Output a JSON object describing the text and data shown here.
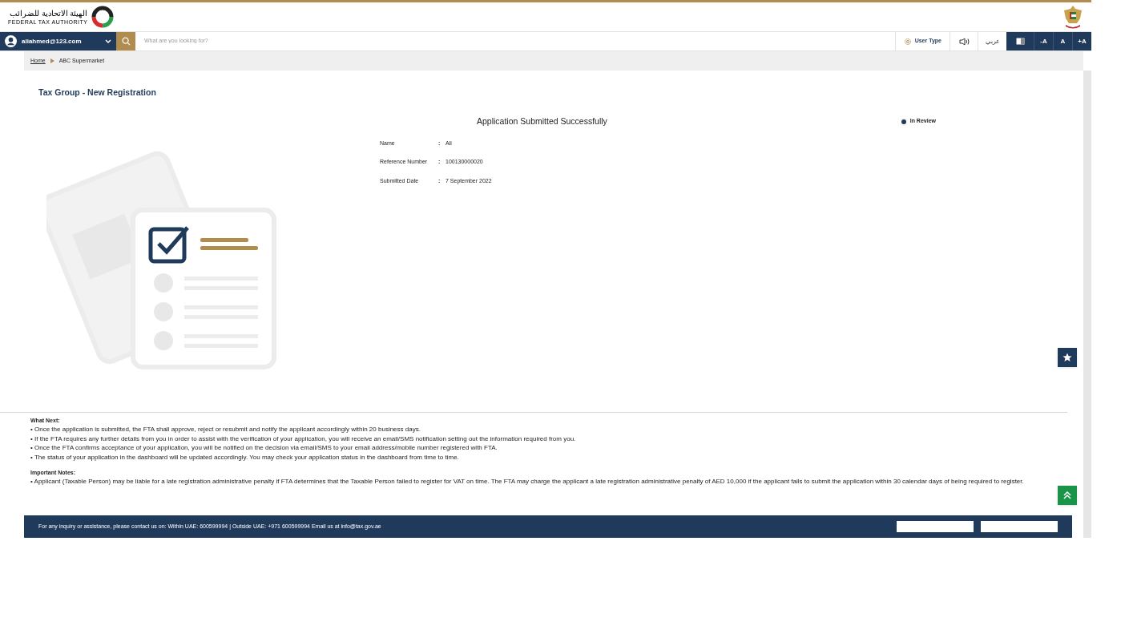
{
  "header": {
    "logo_arabic": "الهيئة الاتحادية للضرائب",
    "logo_english": "FEDERAL TAX AUTHORITY"
  },
  "nav": {
    "user_email": "aliahmed@123.com",
    "search_placeholder": "What are you looking for?",
    "user_type": "User Type",
    "language": "عربي",
    "font_buttons": [
      "-A",
      "A",
      "+A"
    ]
  },
  "breadcrumb": [
    {
      "label": "Home",
      "link": true
    },
    {
      "label": "ABC Supermarket",
      "link": false
    }
  ],
  "page_title": "Tax Group - New Registration",
  "confirmation": {
    "heading": "Application Submitted Successfully",
    "status": {
      "label": "In Review",
      "color": "#1f3a5a"
    },
    "fields": [
      {
        "label": "Name",
        "separator": ":",
        "value": "Ali"
      },
      {
        "label": "Reference Number",
        "separator": ":",
        "value": "100130000020"
      },
      {
        "label": "Submitted Date",
        "separator": ":",
        "value": "7 September 2022"
      }
    ]
  },
  "what_next": {
    "heading": "What Next:",
    "items": [
      "• Once the application is submitted, the FTA shall approve, reject or resubmit and notify the applicant accordingly within 20 business days.",
      "• If the FTA requires any further details from you in order to assist with the verification of your application, you will receive an email/SMS notification setting out the information required from you.",
      "• Once the FTA confirms acceptance of your application, you will be notified on the decision via email/SMS to your email address/mobile number registered with FTA.",
      "• The status of your application in the dashboard will be updated accordingly. You may check your application status in the dashboard from time to time."
    ]
  },
  "important_notes": {
    "heading": "Important Notes:",
    "items": [
      "• Applicant (Taxable Person) may be liable for a late registration administrative penalty if FTA determines that the Taxable Person failed to register for VAT on time. The FTA may charge the applicant a late registration administrative penalty of AED 10,000 if the applicant fails to submit the application within 30 calendar days of being required to register."
    ]
  },
  "footer": {
    "contact": "For any inquiry or assistance, please contact us on: Within UAE: 600599994 | Outside UAE: +971 600599994 Email us at info@tax.gov.ae"
  }
}
